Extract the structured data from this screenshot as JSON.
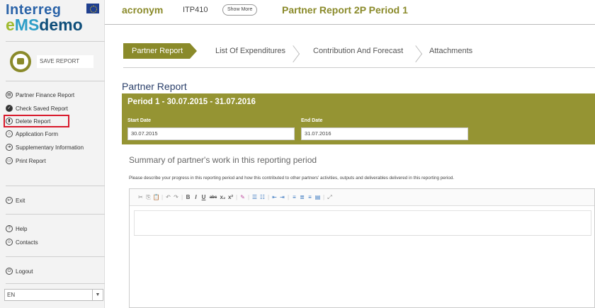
{
  "logo": {
    "line1": "Interreg",
    "line2_e": "e",
    "line2_ms": "MS",
    "line2_rest": "demo"
  },
  "sidebar": {
    "save_label": "SAVE REPORT",
    "items": [
      {
        "label": "Partner Finance Report",
        "icon": "finance-icon"
      },
      {
        "label": "Check Saved Report",
        "icon": "check-icon"
      },
      {
        "label": "Delete Report",
        "icon": "trash-icon"
      },
      {
        "label": "Application Form",
        "icon": "home-icon"
      },
      {
        "label": "Supplementary Information",
        "icon": "arrow-icon"
      },
      {
        "label": "Print Report",
        "icon": "print-icon"
      }
    ],
    "exit_label": "Exit",
    "help_label": "Help",
    "contacts_label": "Contacts",
    "logout_label": "Logout",
    "language": "EN",
    "language_caret": "▼"
  },
  "header": {
    "acronym": "acronym",
    "code": "ITP410",
    "show_more": "Show More",
    "title": "Partner Report 2P Period 1"
  },
  "tabs": [
    {
      "label": "Partner Report",
      "active": true
    },
    {
      "label": "List Of Expenditures",
      "active": false
    },
    {
      "label": "Contribution And Forecast",
      "active": false
    },
    {
      "label": "Attachments",
      "active": false
    }
  ],
  "main": {
    "section_title": "Partner Report",
    "period_title": "Period 1 - 30.07.2015 - 31.07.2016",
    "start_label": "Start Date",
    "start_value": "30.07.2015",
    "end_label": "End Date",
    "end_value": "31.07.2016",
    "summary_title": "Summary of partner's work in this reporting period",
    "summary_desc": "Please describe your progress in this reporting period and how this contributed to other partners' activities, outputs and deliverables delivered in this reporting period."
  },
  "toolbar_glyphs": [
    "✂",
    "⎘",
    "📋",
    "|",
    "↶",
    "↷",
    "|",
    "B",
    "I",
    "U",
    "abc",
    "x₂",
    "x²",
    "|",
    "✎",
    "|",
    "☰",
    "☷",
    "|",
    "⇤",
    "⇥",
    "|",
    "≡",
    "≣",
    "≡",
    "▤",
    "|",
    "⤢"
  ],
  "colors": {
    "accent": "#8a8a2a",
    "period_bg": "#959433",
    "highlight": "#d8192b",
    "title_blue": "#2a3f6a"
  }
}
